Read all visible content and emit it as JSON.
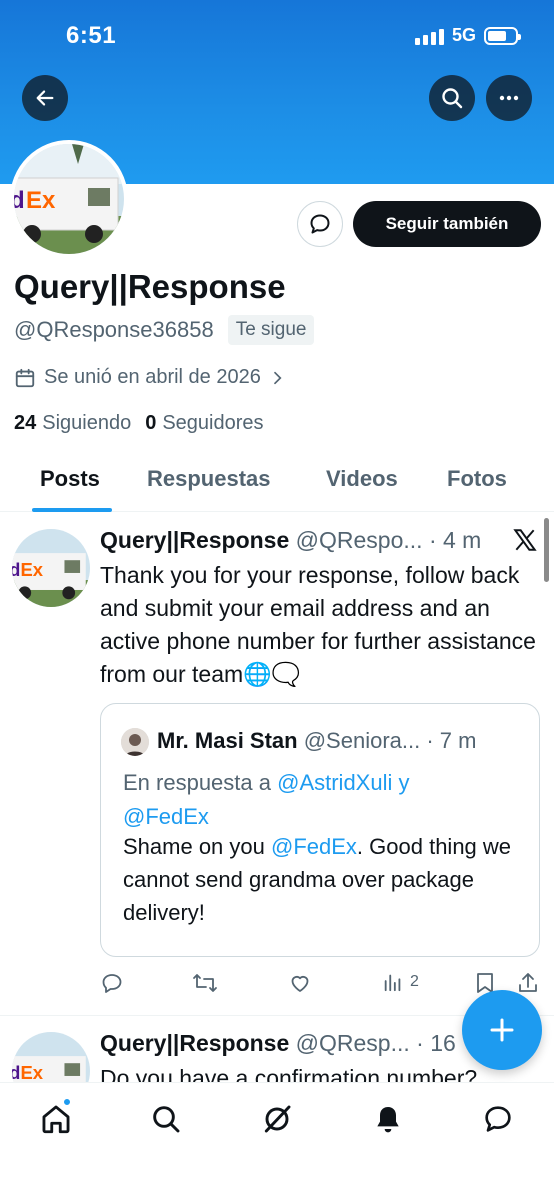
{
  "status_bar": {
    "time": "6:51",
    "network": "5G"
  },
  "profile": {
    "display_name": "Query||Response",
    "handle": "@QResponse36858",
    "follows_you": "Te sigue",
    "joined": "Se unió en abril de 2026",
    "following_count": "24",
    "following_label": "Siguiendo",
    "followers_count": "0",
    "followers_label": "Seguidores",
    "follow_button": "Seguir también",
    "avatar_logo_text": "dEx"
  },
  "tabs": [
    {
      "label": "Posts",
      "active": true
    },
    {
      "label": "Respuestas",
      "active": false
    },
    {
      "label": "Videos",
      "active": false
    },
    {
      "label": "Fotos",
      "active": false
    }
  ],
  "posts": [
    {
      "name": "Query||Response",
      "meta": "@QRespo... · 4 m",
      "text": "Thank you for your response, follow back and submit your email address and an active phone number for further assistance from our team🌐🗨️",
      "quote": {
        "name": "Mr. Masi Stan",
        "meta": "@Seniora... · 7 m",
        "reply_prefix": "En respuesta a",
        "reply_user1": "@AstridXuli",
        "reply_and": "y",
        "reply_user2": "@FedEx",
        "text_before": "Shame on you",
        "text_mention": "@FedEx",
        "text_after": ". Good thing we cannot send grandma over package delivery!"
      },
      "views": "2"
    },
    {
      "name": "Query||Response",
      "meta": "@QResp... · 16",
      "text": "Do you have a confirmation number?"
    }
  ],
  "colors": {
    "accent": "#1d9bf0",
    "text": "#0f1419",
    "secondary": "#536471",
    "banner": "#1d8ee6"
  },
  "icons": {
    "back": "arrow-left-icon",
    "search": "search-icon",
    "more": "more-horizontal-icon",
    "message": "message-bubble-icon",
    "calendar": "calendar-icon",
    "x_logo": "x-logo-icon",
    "reply": "reply-icon",
    "repost": "repost-icon",
    "like": "heart-icon",
    "views": "views-icon",
    "bookmark": "bookmark-icon",
    "share": "share-icon",
    "compose": "plus-icon",
    "nav": [
      "home-icon",
      "search-icon",
      "grok-icon",
      "bell-icon",
      "messages-icon"
    ]
  }
}
